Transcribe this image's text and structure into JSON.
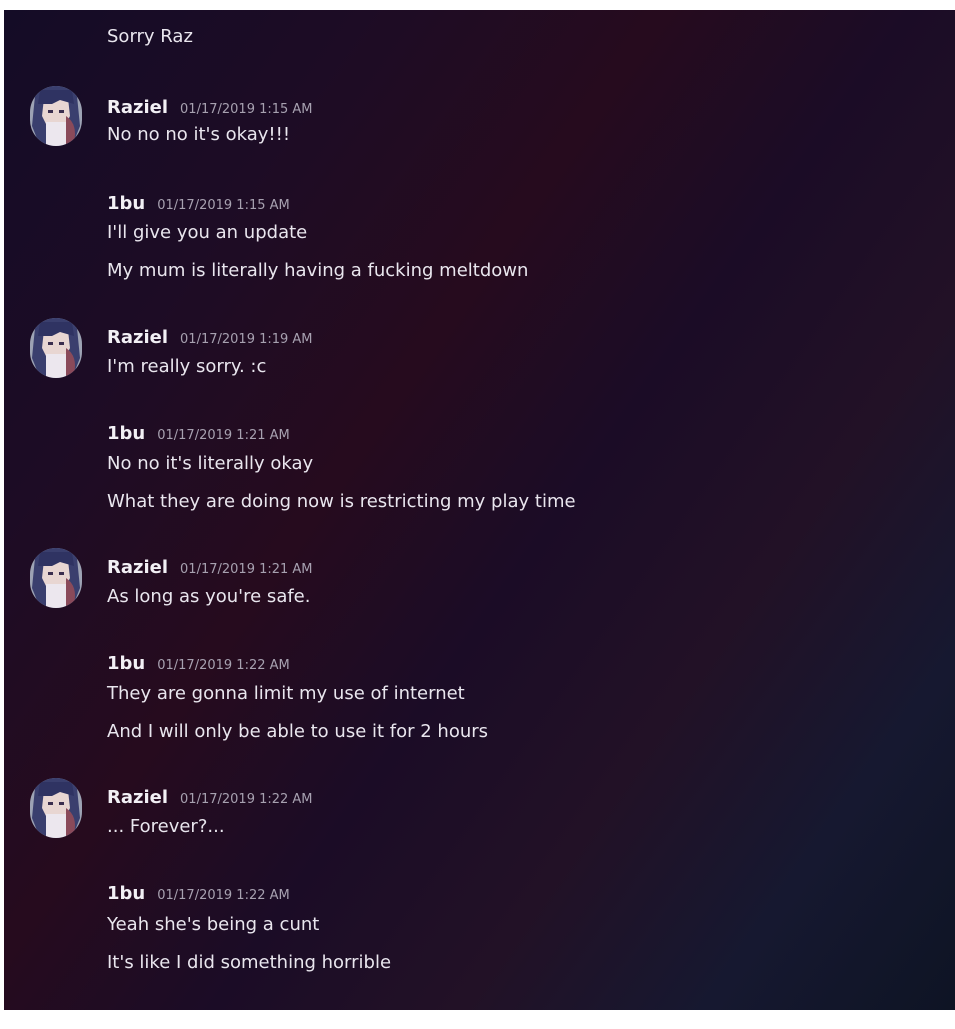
{
  "chat": {
    "first_line": "Sorry Raz",
    "groups": [
      {
        "username": "Raziel",
        "timestamp": "01/17/2019 1:15 AM",
        "has_avatar": true,
        "lines": [
          "No no no it's okay!!!"
        ]
      },
      {
        "username": "1bu",
        "timestamp": "01/17/2019 1:15 AM",
        "has_avatar": false,
        "lines": [
          "I'll give you an update",
          "My mum is literally having a fucking meltdown"
        ]
      },
      {
        "username": "Raziel",
        "timestamp": "01/17/2019 1:19 AM",
        "has_avatar": true,
        "lines": [
          "I'm really sorry. :c"
        ]
      },
      {
        "username": "1bu",
        "timestamp": "01/17/2019 1:21 AM",
        "has_avatar": false,
        "lines": [
          "No  no it's literally okay",
          "What they are doing now is restricting my play time"
        ]
      },
      {
        "username": "Raziel",
        "timestamp": "01/17/2019 1:21 AM",
        "has_avatar": true,
        "lines": [
          "As long as you're safe."
        ]
      },
      {
        "username": "1bu",
        "timestamp": "01/17/2019 1:22 AM",
        "has_avatar": false,
        "lines": [
          "They are gonna limit my use of internet",
          "And I will only be able to use it for 2 hours"
        ]
      },
      {
        "username": "Raziel",
        "timestamp": "01/17/2019 1:22 AM",
        "has_avatar": true,
        "lines": [
          "... Forever?..."
        ]
      },
      {
        "username": "1bu",
        "timestamp": "01/17/2019 1:22 AM",
        "has_avatar": false,
        "lines": [
          "Yeah she's being a cunt",
          "It's like I did something horrible"
        ]
      }
    ]
  },
  "colors": {
    "username": "#f2f0f5",
    "message_text": "#e9e6ee",
    "timestamp": "#a7a1b0"
  },
  "icons": {
    "avatar": "anime-character-avatar"
  }
}
